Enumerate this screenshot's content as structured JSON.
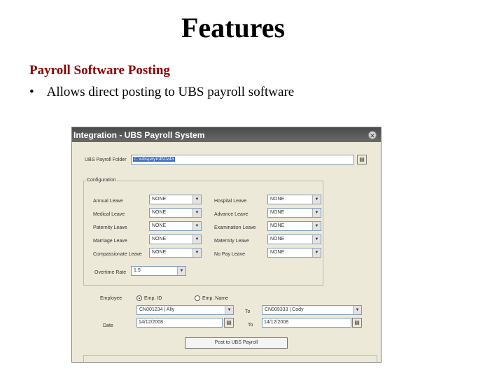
{
  "slide": {
    "title": "Features",
    "subheading": "Payroll Software Posting",
    "bullet_symbol": "•",
    "bullet_text": "Allows direct posting to UBS payroll software"
  },
  "window": {
    "title": "Integration - UBS Payroll System",
    "close_icon": "✕",
    "payroll_folder": {
      "label": "UBS Payroll Folder",
      "value": "C:\\ubspayroll\\Data"
    },
    "browse_icon": "▤",
    "configuration": {
      "legend": "Configuration",
      "dropdown_arrow": "▼",
      "left_fields": [
        {
          "label": "Annual Leave",
          "value": "NONE"
        },
        {
          "label": "Medical Leave",
          "value": "NONE"
        },
        {
          "label": "Paternity Leave",
          "value": "NONE"
        },
        {
          "label": "Marriage Leave",
          "value": "NONE"
        },
        {
          "label": "Compassionate Leave",
          "value": "NONE"
        }
      ],
      "right_fields": [
        {
          "label": "Hospital Leave",
          "value": "NONE"
        },
        {
          "label": "Advance Leave",
          "value": "NONE"
        },
        {
          "label": "Examination Leave",
          "value": "NONE"
        },
        {
          "label": "Maternity Leave",
          "value": "NONE"
        },
        {
          "label": "No Pay Leave",
          "value": "NONE"
        }
      ],
      "overtime_rate": {
        "label": "Overtime Rate",
        "value": "1.5"
      }
    },
    "employee": {
      "label": "Employee",
      "radio_emp_id": "Emp. ID",
      "radio_emp_name": "Emp. Name",
      "from_value": "CN001234 | Ally",
      "to_label": "To",
      "to_value": "CN009333 | Cody"
    },
    "date": {
      "label": "Date",
      "from_value": "14/12/2008",
      "to_label": "To",
      "to_value": "14/12/2008"
    },
    "post_button": "Post to UBS Payroll"
  }
}
